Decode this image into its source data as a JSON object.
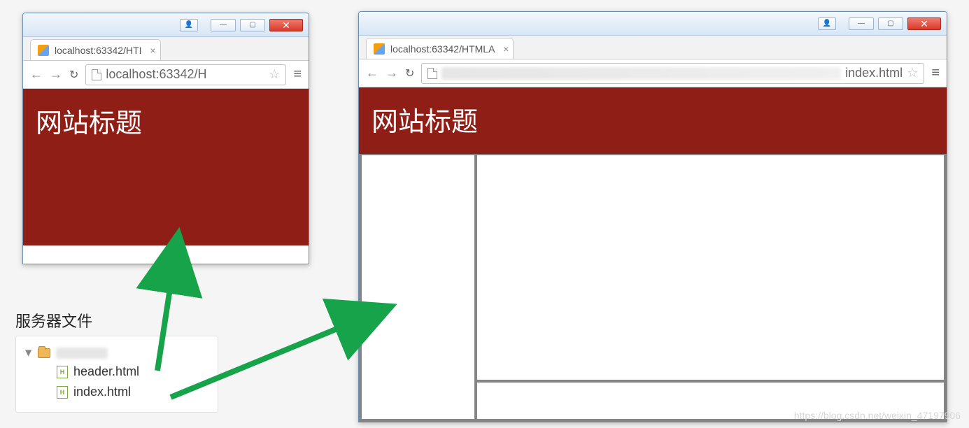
{
  "website": {
    "title": "网站标题"
  },
  "windows": {
    "small": {
      "tab_title": "localhost:63342/HTI",
      "url_text": "localhost:63342/H"
    },
    "large": {
      "tab_title": "localhost:63342/HTMLA",
      "url_suffix": "index.html"
    }
  },
  "file_tree": {
    "section_title": "服务器文件",
    "files": [
      {
        "name": "header.html"
      },
      {
        "name": "index.html"
      }
    ]
  },
  "watermark": "https://blog.csdn.net/weixin_47197906",
  "colors": {
    "header_bg": "#8f1e16",
    "arrow_green": "#17a34a"
  }
}
